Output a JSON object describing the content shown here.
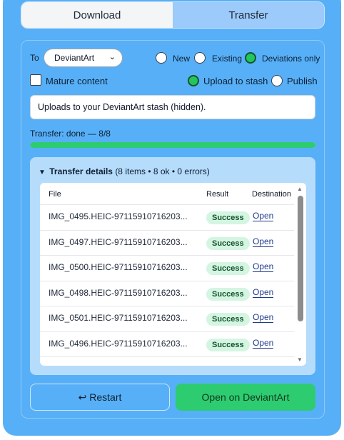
{
  "tabs": [
    {
      "label": "Download",
      "active": false
    },
    {
      "label": "Transfer",
      "active": true
    }
  ],
  "form": {
    "to_label": "To",
    "destination": "DeviantArt",
    "mode_options": [
      {
        "label": "New",
        "selected": false
      },
      {
        "label": "Existing",
        "selected": false
      },
      {
        "label": "Deviations only",
        "selected": true
      }
    ],
    "mature_label": "Mature content",
    "mature_checked": false,
    "publish_options": [
      {
        "label": "Upload to stash",
        "selected": true
      },
      {
        "label": "Publish",
        "selected": false
      }
    ],
    "info_text": "Uploads to your DeviantArt stash (hidden)."
  },
  "status": {
    "text": "Transfer: done — 8/8",
    "progress": 1.0
  },
  "details": {
    "title": "Transfer details",
    "summary": "(8 items • 8 ok • 0 errors)",
    "columns": [
      "File",
      "Result",
      "Destination"
    ],
    "rows": [
      {
        "file": "IMG_0495.HEIC-97115910716203...",
        "result": "Success",
        "link": "Open"
      },
      {
        "file": "IMG_0497.HEIC-97115910716203...",
        "result": "Success",
        "link": "Open"
      },
      {
        "file": "IMG_0500.HEIC-97115910716203...",
        "result": "Success",
        "link": "Open"
      },
      {
        "file": "IMG_0498.HEIC-97115910716203...",
        "result": "Success",
        "link": "Open"
      },
      {
        "file": "IMG_0501.HEIC-97115910716203...",
        "result": "Success",
        "link": "Open"
      },
      {
        "file": "IMG_0496.HEIC-97115910716203...",
        "result": "Success",
        "link": "Open"
      }
    ]
  },
  "actions": {
    "restart_label": "↩ Restart",
    "open_label": "Open on DeviantArt"
  },
  "colors": {
    "panel": "#57b0f7",
    "success": "#2ecc71",
    "active_tab": "#9ccafa"
  }
}
